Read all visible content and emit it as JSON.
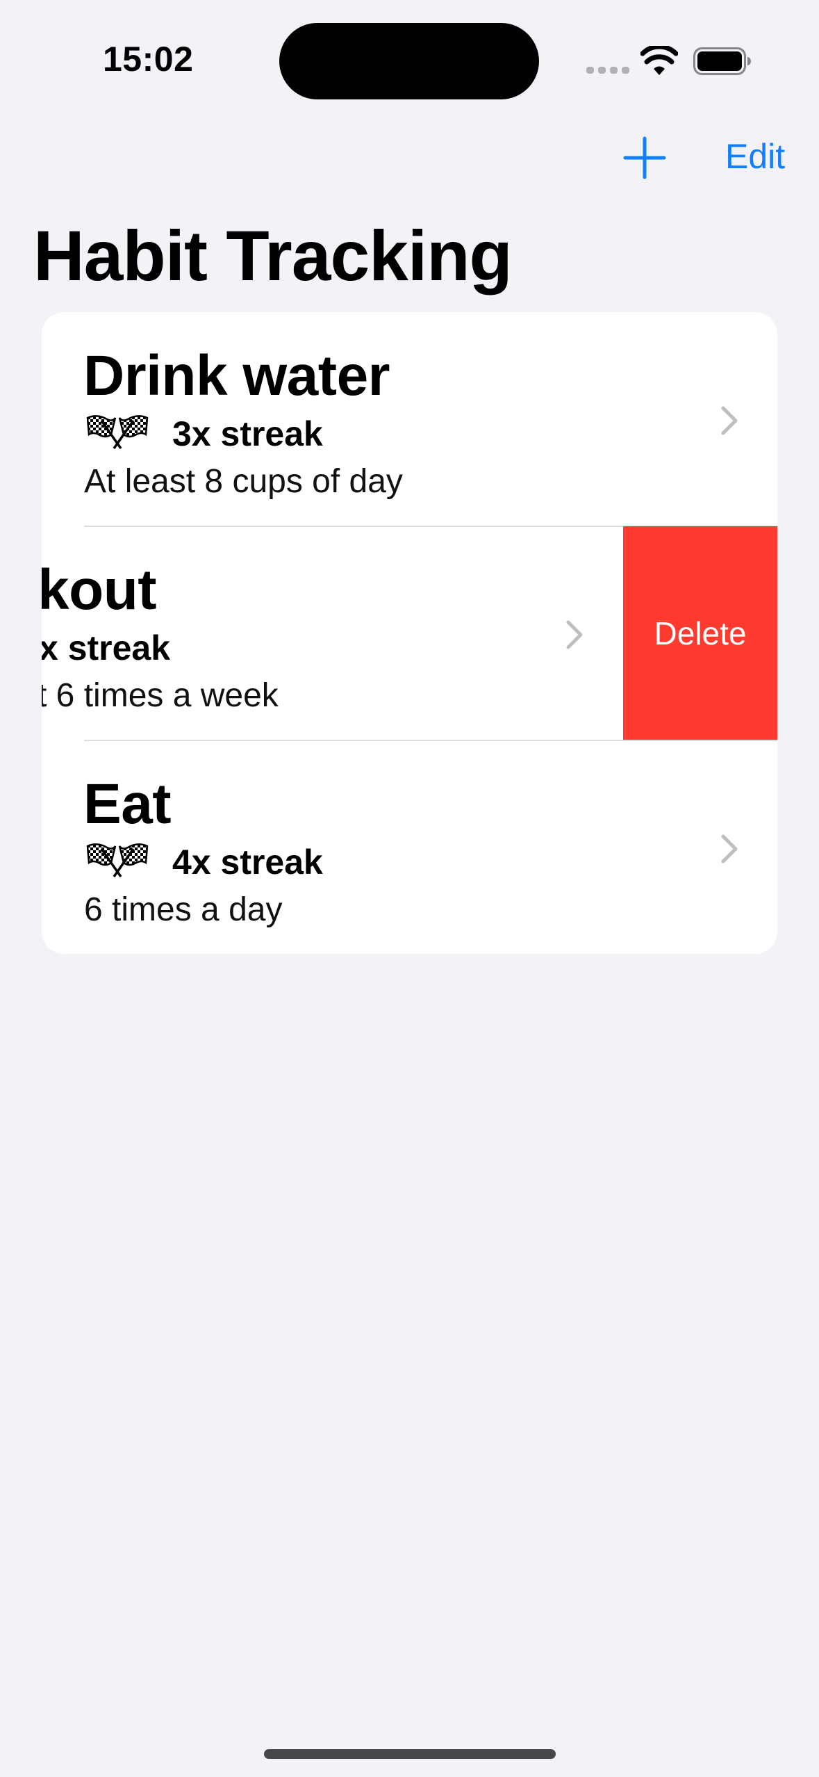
{
  "status_bar": {
    "time": "15:02",
    "icons": [
      "cellular-signal-icon",
      "wifi-icon",
      "battery-icon"
    ]
  },
  "nav": {
    "add_icon": "plus-icon",
    "edit_label": "Edit"
  },
  "page_title": "Habit Tracking",
  "colors": {
    "accent": "#147EFB",
    "background": "#F2F2F7",
    "delete": "#FF3B30"
  },
  "habits": [
    {
      "title": "Drink water",
      "streak_icon": "checkered-flags-icon",
      "streak": "3x streak",
      "description": "At least 8 cups of day"
    },
    {
      "title": "kout",
      "streak": "x streak",
      "description": "t 6 times a week",
      "swiped": true,
      "delete_label": "Delete"
    },
    {
      "title": "Eat",
      "streak_icon": "checkered-flags-icon",
      "streak": "4x streak",
      "description": "6 times a day"
    }
  ]
}
